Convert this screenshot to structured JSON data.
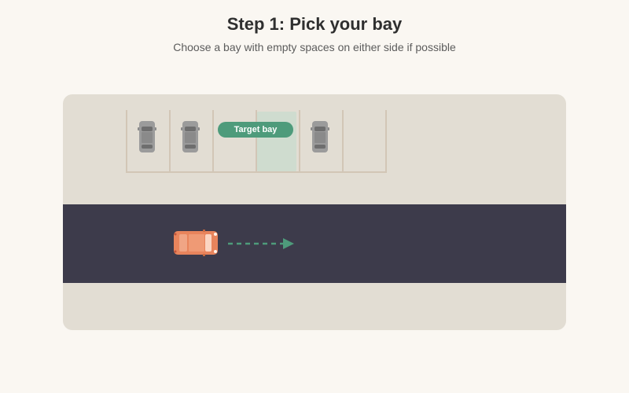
{
  "header": {
    "title": "Step 1: Pick your bay",
    "subtitle": "Choose a bay with empty spaces on either side if possible"
  },
  "lot": {
    "bay_count": 6,
    "target_bay_index": 3,
    "occupied_bays": [
      0,
      1,
      4
    ],
    "target_label": "Target bay"
  },
  "colors": {
    "background": "#faf7f2",
    "ground": "#e2ddd3",
    "road": "#3d3b4b",
    "parked_car": "#9b9b9b",
    "player_car": "#e8845c",
    "accent_green": "#4e9b7b",
    "target_fill": "#cfdccf",
    "bay_lines": "#d2c6b6"
  },
  "icons": {
    "parked_car": "car-top-view-icon",
    "player_car": "car-top-view-icon",
    "direction": "dashed-arrow-right-icon"
  }
}
